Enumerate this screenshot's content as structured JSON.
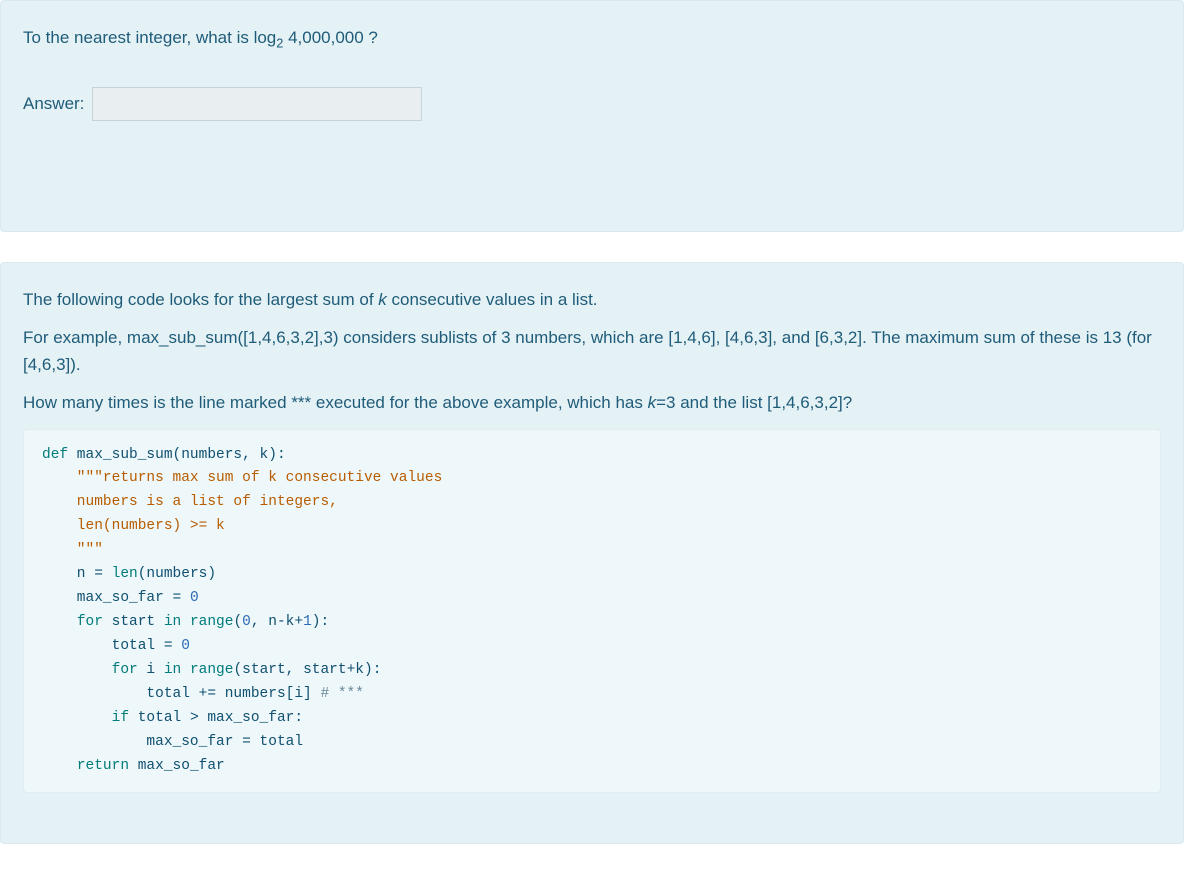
{
  "q1": {
    "prompt_pre": "To the nearest integer, what is log",
    "sub": "2",
    "prompt_post": " 4,000,000 ?",
    "answer_label": "Answer:",
    "answer_value": ""
  },
  "q2": {
    "p1_pre": "The following code looks for the largest sum of ",
    "p1_k": "k",
    "p1_post": " consecutive values in a list.",
    "p2": "For example, max_sub_sum([1,4,6,3,2],3) considers sublists of 3 numbers, which are [1,4,6], [4,6,3], and [6,3,2]. The maximum sum of these is 13 (for [4,6,3]).",
    "p3_pre": "How many times is the line marked *** executed for the above example, which has ",
    "p3_k": "k",
    "p3_mid": "=3 and the list [1,4,6,3,2]?",
    "code": {
      "l01_def": "def",
      "l01_rest": " max_sub_sum(numbers, k):",
      "l02": "    \"\"\"returns max sum of k consecutive values",
      "l03": "    numbers is a list of integers,",
      "l04": "    len(numbers) >= k",
      "l05": "    \"\"\"",
      "l06_a": "    n = ",
      "l06_len": "len",
      "l06_b": "(numbers)",
      "l07_a": "    max_so_far = ",
      "l07_num": "0",
      "l08_a": "    ",
      "l08_for": "for",
      "l08_b": " start ",
      "l08_in": "in",
      "l08_c": " ",
      "l08_range": "range",
      "l08_d": "(",
      "l08_z": "0",
      "l08_e": ", n-k+",
      "l08_one": "1",
      "l08_f": "):",
      "l09_a": "        total = ",
      "l09_num": "0",
      "l10_a": "        ",
      "l10_for": "for",
      "l10_b": " i ",
      "l10_in": "in",
      "l10_c": " ",
      "l10_range": "range",
      "l10_d": "(start, start+k):",
      "l11_a": "            total += numbers[i] ",
      "l11_cmt": "# ***",
      "l12_a": "        ",
      "l12_if": "if",
      "l12_b": " total > max_so_far:",
      "l13": "            max_so_far = total",
      "l14_a": "    ",
      "l14_ret": "return",
      "l14_b": " max_so_far"
    }
  }
}
